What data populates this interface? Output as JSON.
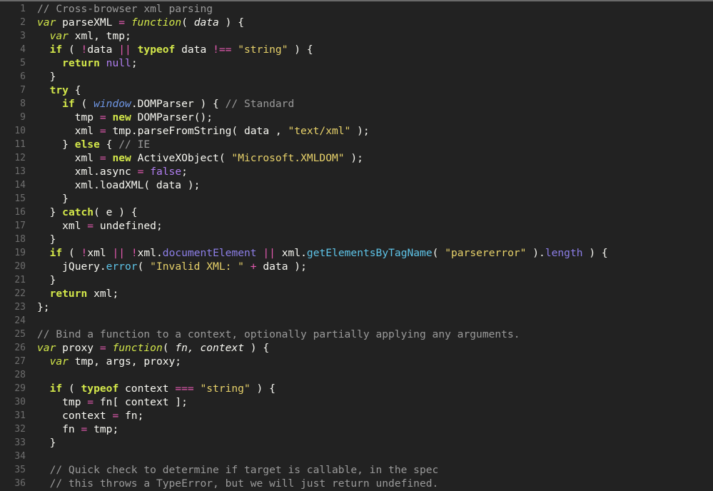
{
  "editor": {
    "lines": [
      {
        "n": "1",
        "t": [
          [
            "cmt",
            "// Cross-browser xml parsing"
          ]
        ]
      },
      {
        "n": "2",
        "t": [
          [
            "kwi",
            "var"
          ],
          [
            "pl",
            " parseXML "
          ],
          [
            "op",
            "="
          ],
          [
            "pl",
            " "
          ],
          [
            "kwi",
            "function"
          ],
          [
            "pl",
            "( "
          ],
          [
            "prm",
            "data"
          ],
          [
            "pl",
            " ) {"
          ]
        ]
      },
      {
        "n": "3",
        "t": [
          [
            "pl",
            "  "
          ],
          [
            "kwi",
            "var"
          ],
          [
            "pl",
            " xml, tmp;"
          ]
        ]
      },
      {
        "n": "4",
        "t": [
          [
            "pl",
            "  "
          ],
          [
            "kw",
            "if"
          ],
          [
            "pl",
            " ( "
          ],
          [
            "op",
            "!"
          ],
          [
            "pl",
            "data "
          ],
          [
            "op",
            "||"
          ],
          [
            "pl",
            " "
          ],
          [
            "kw",
            "typeof"
          ],
          [
            "pl",
            " data "
          ],
          [
            "op",
            "!=="
          ],
          [
            "pl",
            " "
          ],
          [
            "str",
            "\"string\""
          ],
          [
            "pl",
            " ) {"
          ]
        ]
      },
      {
        "n": "5",
        "t": [
          [
            "pl",
            "    "
          ],
          [
            "kw",
            "return"
          ],
          [
            "pl",
            " "
          ],
          [
            "lit",
            "null"
          ],
          [
            "pl",
            ";"
          ]
        ]
      },
      {
        "n": "6",
        "t": [
          [
            "pl",
            "  }"
          ]
        ]
      },
      {
        "n": "7",
        "t": [
          [
            "pl",
            "  "
          ],
          [
            "kw",
            "try"
          ],
          [
            "pl",
            " {"
          ]
        ]
      },
      {
        "n": "8",
        "t": [
          [
            "pl",
            "    "
          ],
          [
            "kw",
            "if"
          ],
          [
            "pl",
            " ( "
          ],
          [
            "glob",
            "window"
          ],
          [
            "pl",
            ".DOMParser ) { "
          ],
          [
            "cmt",
            "// Standard"
          ]
        ]
      },
      {
        "n": "9",
        "t": [
          [
            "pl",
            "      tmp "
          ],
          [
            "op",
            "="
          ],
          [
            "pl",
            " "
          ],
          [
            "kw",
            "new"
          ],
          [
            "pl",
            " DOMParser();"
          ]
        ]
      },
      {
        "n": "10",
        "t": [
          [
            "pl",
            "      xml "
          ],
          [
            "op",
            "="
          ],
          [
            "pl",
            " tmp.parseFromString( data , "
          ],
          [
            "str",
            "\"text/xml\""
          ],
          [
            "pl",
            " );"
          ]
        ]
      },
      {
        "n": "11",
        "t": [
          [
            "pl",
            "    } "
          ],
          [
            "kw",
            "else"
          ],
          [
            "pl",
            " { "
          ],
          [
            "cmt",
            "// IE"
          ]
        ]
      },
      {
        "n": "12",
        "t": [
          [
            "pl",
            "      xml "
          ],
          [
            "op",
            "="
          ],
          [
            "pl",
            " "
          ],
          [
            "kw",
            "new"
          ],
          [
            "pl",
            " ActiveXObject( "
          ],
          [
            "str",
            "\"Microsoft.XMLDOM\""
          ],
          [
            "pl",
            " );"
          ]
        ]
      },
      {
        "n": "13",
        "t": [
          [
            "pl",
            "      xml.async "
          ],
          [
            "op",
            "="
          ],
          [
            "pl",
            " "
          ],
          [
            "lit",
            "false"
          ],
          [
            "pl",
            ";"
          ]
        ]
      },
      {
        "n": "14",
        "t": [
          [
            "pl",
            "      xml.loadXML( data );"
          ]
        ]
      },
      {
        "n": "15",
        "t": [
          [
            "pl",
            "    }"
          ]
        ]
      },
      {
        "n": "16",
        "t": [
          [
            "pl",
            "  } "
          ],
          [
            "kw",
            "catch"
          ],
          [
            "pl",
            "( e ) {"
          ]
        ]
      },
      {
        "n": "17",
        "t": [
          [
            "pl",
            "    xml "
          ],
          [
            "op",
            "="
          ],
          [
            "pl",
            " undefined;"
          ]
        ]
      },
      {
        "n": "18",
        "t": [
          [
            "pl",
            "  }"
          ]
        ]
      },
      {
        "n": "19",
        "t": [
          [
            "pl",
            "  "
          ],
          [
            "kw",
            "if"
          ],
          [
            "pl",
            " ( "
          ],
          [
            "op",
            "!"
          ],
          [
            "pl",
            "xml "
          ],
          [
            "op",
            "||"
          ],
          [
            "pl",
            " "
          ],
          [
            "op",
            "!"
          ],
          [
            "pl",
            "xml."
          ],
          [
            "prop",
            "documentElement"
          ],
          [
            "pl",
            " "
          ],
          [
            "op",
            "||"
          ],
          [
            "pl",
            " xml."
          ],
          [
            "meth",
            "getElementsByTagName"
          ],
          [
            "pl",
            "( "
          ],
          [
            "str",
            "\"parsererror\""
          ],
          [
            "pl",
            " )."
          ],
          [
            "prop",
            "length"
          ],
          [
            "pl",
            " ) {"
          ]
        ]
      },
      {
        "n": "20",
        "t": [
          [
            "pl",
            "    jQuery."
          ],
          [
            "meth",
            "error"
          ],
          [
            "pl",
            "( "
          ],
          [
            "str",
            "\"Invalid XML: \""
          ],
          [
            "pl",
            " "
          ],
          [
            "op",
            "+"
          ],
          [
            "pl",
            " data );"
          ]
        ]
      },
      {
        "n": "21",
        "t": [
          [
            "pl",
            "  }"
          ]
        ]
      },
      {
        "n": "22",
        "t": [
          [
            "pl",
            "  "
          ],
          [
            "kw",
            "return"
          ],
          [
            "pl",
            " xml;"
          ]
        ]
      },
      {
        "n": "23",
        "t": [
          [
            "pl",
            "};"
          ]
        ]
      },
      {
        "n": "24",
        "t": []
      },
      {
        "n": "25",
        "t": [
          [
            "cmt",
            "// Bind a function to a context, optionally partially applying any arguments."
          ]
        ]
      },
      {
        "n": "26",
        "t": [
          [
            "kwi",
            "var"
          ],
          [
            "pl",
            " proxy "
          ],
          [
            "op",
            "="
          ],
          [
            "pl",
            " "
          ],
          [
            "kwi",
            "function"
          ],
          [
            "pl",
            "( "
          ],
          [
            "prm",
            "fn, context"
          ],
          [
            "pl",
            " ) {"
          ]
        ]
      },
      {
        "n": "27",
        "t": [
          [
            "pl",
            "  "
          ],
          [
            "kwi",
            "var"
          ],
          [
            "pl",
            " tmp, args, proxy;"
          ]
        ]
      },
      {
        "n": "28",
        "t": []
      },
      {
        "n": "29",
        "t": [
          [
            "pl",
            "  "
          ],
          [
            "kw",
            "if"
          ],
          [
            "pl",
            " ( "
          ],
          [
            "kw",
            "typeof"
          ],
          [
            "pl",
            " context "
          ],
          [
            "op",
            "==="
          ],
          [
            "pl",
            " "
          ],
          [
            "str",
            "\"string\""
          ],
          [
            "pl",
            " ) {"
          ]
        ]
      },
      {
        "n": "30",
        "t": [
          [
            "pl",
            "    tmp "
          ],
          [
            "op",
            "="
          ],
          [
            "pl",
            " fn[ context ];"
          ]
        ]
      },
      {
        "n": "31",
        "t": [
          [
            "pl",
            "    context "
          ],
          [
            "op",
            "="
          ],
          [
            "pl",
            " fn;"
          ]
        ]
      },
      {
        "n": "32",
        "t": [
          [
            "pl",
            "    fn "
          ],
          [
            "op",
            "="
          ],
          [
            "pl",
            " tmp;"
          ]
        ]
      },
      {
        "n": "33",
        "t": [
          [
            "pl",
            "  }"
          ]
        ]
      },
      {
        "n": "34",
        "t": []
      },
      {
        "n": "35",
        "t": [
          [
            "pl",
            "  "
          ],
          [
            "cmt",
            "// Quick check to determine if target is callable, in the spec"
          ]
        ]
      },
      {
        "n": "36",
        "t": [
          [
            "pl",
            "  "
          ],
          [
            "cmt",
            "// this throws a TypeError, but we will just return undefined."
          ]
        ]
      }
    ]
  }
}
